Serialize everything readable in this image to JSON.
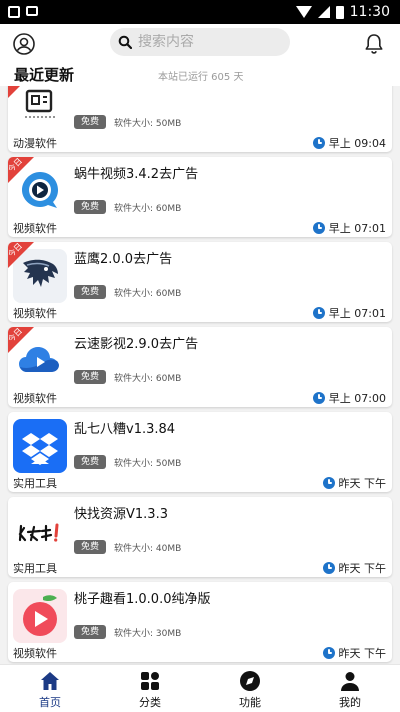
{
  "status_bar": {
    "time": "11:30"
  },
  "header": {
    "search_placeholder": "搜索内容"
  },
  "section": {
    "title": "最近更新",
    "uptime": "本站已运行 605 天"
  },
  "colors": {
    "accent": "#1b3a85",
    "ribbon": "#e2423b",
    "clock": "#1e73c9",
    "tag": "#666666"
  },
  "items": [
    {
      "title": "",
      "tag": "免费",
      "size": "软件大小: 50MB",
      "category": "动漫软件",
      "time": "早上 09:04",
      "badge": "",
      "icon": "anime-app-icon"
    },
    {
      "title": "蜗牛视频3.4.2去广告",
      "tag": "免费",
      "size": "软件大小: 60MB",
      "category": "视频软件",
      "time": "早上 07:01",
      "badge": "今日",
      "icon": "snail-video-icon"
    },
    {
      "title": "蓝鹰2.0.0去广告",
      "tag": "免费",
      "size": "软件大小: 60MB",
      "category": "视频软件",
      "time": "早上 07:01",
      "badge": "今日",
      "icon": "eagle-icon"
    },
    {
      "title": "云速影视2.9.0去广告",
      "tag": "免费",
      "size": "软件大小: 60MB",
      "category": "视频软件",
      "time": "早上 07:00",
      "badge": "今日",
      "icon": "cloud-video-icon"
    },
    {
      "title": "乱七八糟v1.3.84",
      "tag": "免费",
      "size": "软件大小: 50MB",
      "category": "实用工具",
      "time": "昨天 下午",
      "badge": "",
      "icon": "dropbox-icon"
    },
    {
      "title": "快找资源V1.3.3",
      "tag": "免费",
      "size": "软件大小: 40MB",
      "category": "实用工具",
      "time": "昨天 下午",
      "badge": "",
      "icon": "kuaizhao-icon"
    },
    {
      "title": "桃子趣看1.0.0.0纯净版",
      "tag": "免费",
      "size": "软件大小: 30MB",
      "category": "视频软件",
      "time": "昨天 下午",
      "badge": "",
      "icon": "peach-play-icon"
    }
  ],
  "nav": [
    {
      "label": "首页",
      "icon": "home-icon",
      "active": true
    },
    {
      "label": "分类",
      "icon": "grid-icon",
      "active": false
    },
    {
      "label": "功能",
      "icon": "compass-icon",
      "active": false
    },
    {
      "label": "我的",
      "icon": "person-icon",
      "active": false
    }
  ]
}
